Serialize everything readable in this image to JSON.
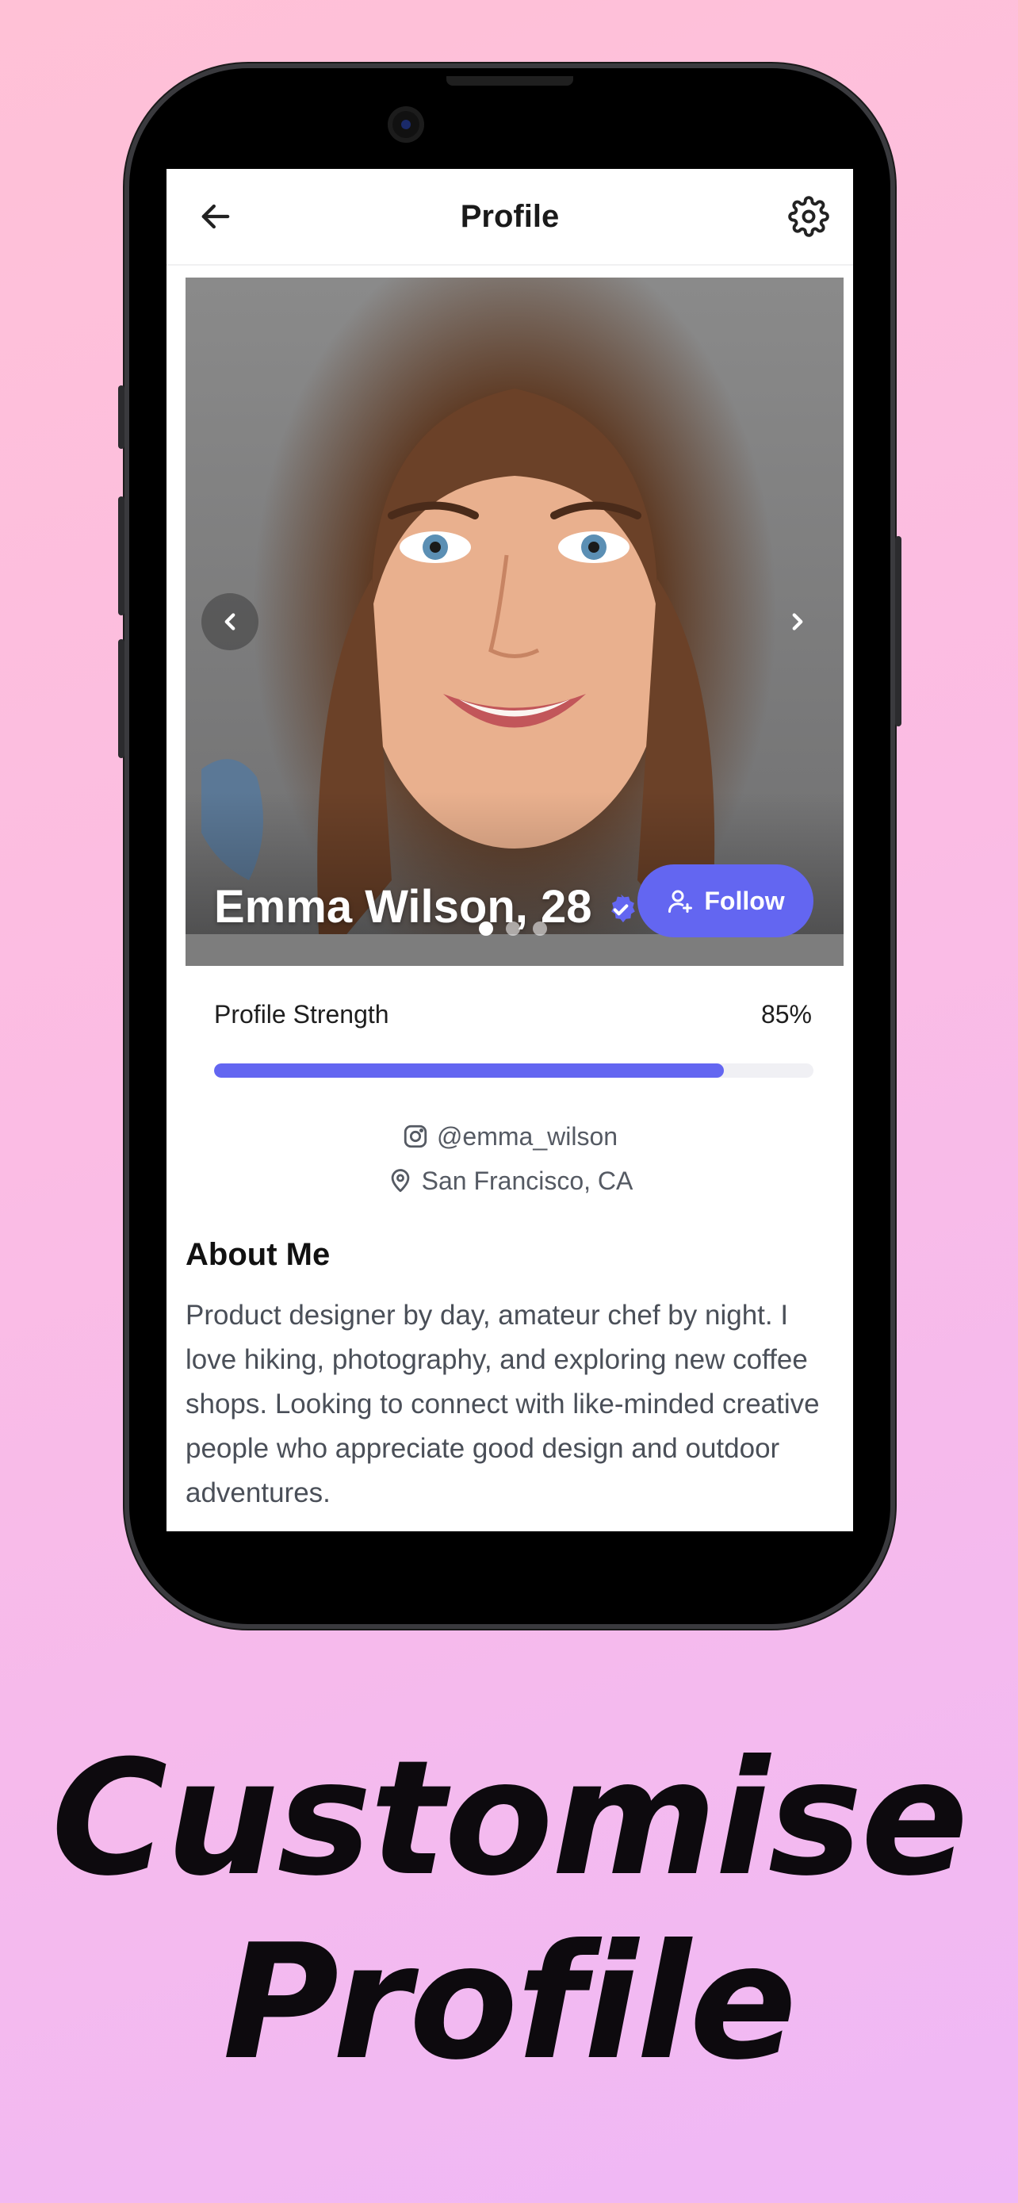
{
  "app": {
    "title": "Profile",
    "back_icon": "arrow-left-icon",
    "settings_icon": "gear-icon"
  },
  "profile": {
    "name_age": "Emma Wilson, 28",
    "verified_icon": "verified-badge-icon",
    "follow_label": "Follow",
    "photo_count": 3,
    "active_photo": 1,
    "strength_label": "Profile Strength",
    "strength_value": "85%",
    "strength_fraction": 0.85,
    "instagram": "@emma_wilson",
    "location": "San Francisco, CA"
  },
  "about": {
    "title": "About Me",
    "text": "Product designer by day, amateur chef by night. I love hiking, photography, and exploring new coffee shops. Looking to connect with like-minded creative people who appreciate good design and outdoor adventures."
  },
  "headline": {
    "line1": "Customise",
    "line2": "Profile"
  },
  "colors": {
    "accent": "#6366f1",
    "background_top": "#ffc1d6",
    "background_bottom": "#efb8f6"
  }
}
